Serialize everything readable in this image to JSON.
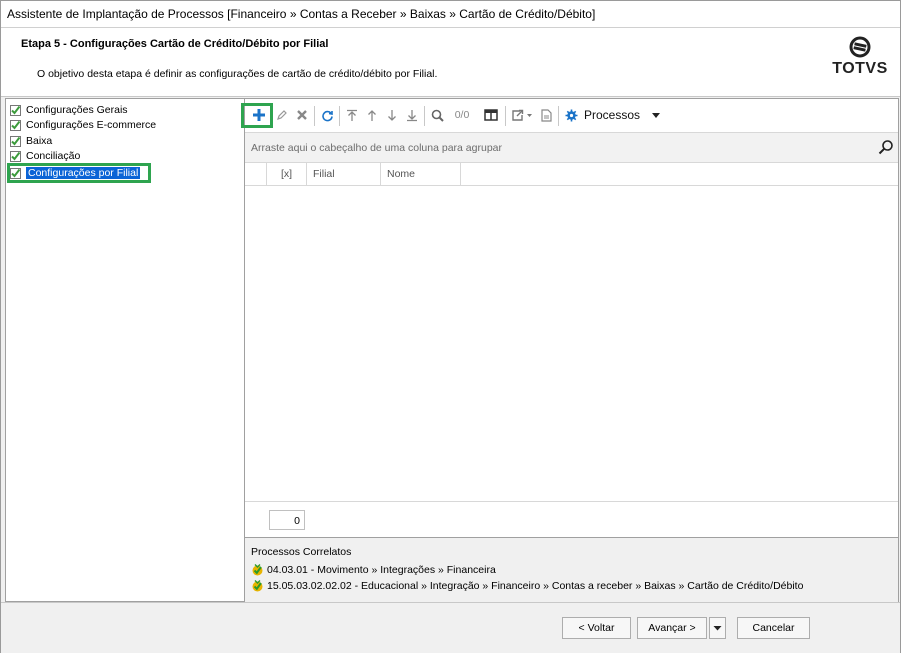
{
  "window": {
    "title": "Assistente de Implantação de Processos [Financeiro » Contas a Receber » Baixas » Cartão de Crédito/Débito]"
  },
  "header": {
    "step_title": "Etapa 5 - Configurações Cartão de Crédito/Débito por Filial",
    "step_description": "O objetivo desta etapa é definir as configurações de cartão de crédito/débito por Filial.",
    "logo_text": "TOTVS"
  },
  "tree": {
    "items": [
      {
        "label": "Configurações Gerais",
        "checked": true,
        "selected": false
      },
      {
        "label": "Configurações E-commerce",
        "checked": true,
        "selected": false
      },
      {
        "label": "Baixa",
        "checked": true,
        "selected": false
      },
      {
        "label": "Conciliação",
        "checked": true,
        "selected": false
      },
      {
        "label": "Configurações por Filial",
        "checked": true,
        "selected": true
      }
    ]
  },
  "toolbar": {
    "record_count": "0/0",
    "processes_label": "Processos",
    "icons": [
      "add-icon",
      "edit-icon",
      "delete-icon",
      "refresh-icon",
      "move-first-icon",
      "move-up-icon",
      "move-down-icon",
      "move-last-icon",
      "search-icon",
      "columns-icon",
      "export-icon",
      "report-icon",
      "gear-icon"
    ]
  },
  "grid": {
    "group_hint": "Arraste aqui o cabeçalho de uma coluna para agrupar",
    "columns": [
      "[x]",
      "Filial",
      "Nome"
    ],
    "rows": [],
    "total": "0"
  },
  "related": {
    "title": "Processos Correlatos",
    "items": [
      "04.03.01 - Movimento » Integrações » Financeira",
      "15.05.03.02.02.02 - Educacional » Integração » Financeiro » Contas a receber » Baixas » Cartão de Crédito/Débito"
    ]
  },
  "buttons": {
    "back": "< Voltar",
    "next": "Avançar >",
    "cancel": "Cancelar"
  },
  "colors": {
    "highlight": "#2ea44f",
    "selection": "#0a64d6",
    "add_icon": "#1a73c8",
    "refresh_icon": "#1a73c8",
    "gear_icon": "#1a73c8",
    "check_green": "#4caf50"
  }
}
